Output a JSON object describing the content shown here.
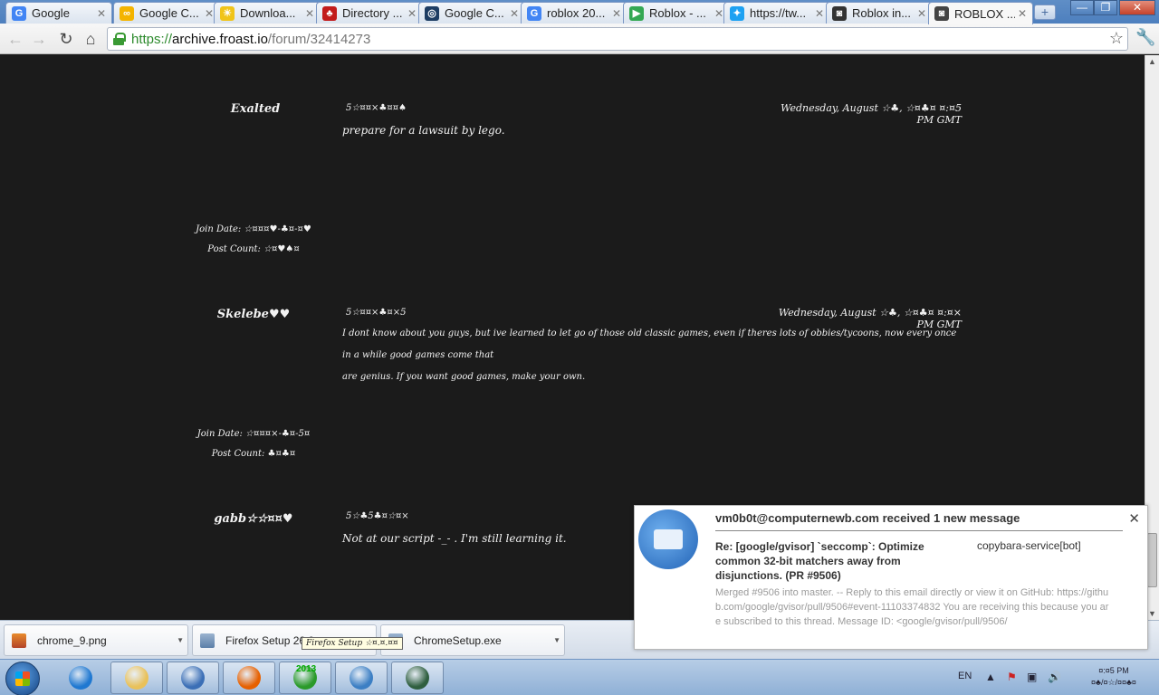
{
  "browser": {
    "tabs": [
      {
        "title": "Google",
        "favicon": "google-icon",
        "color": "#4285f4",
        "glyph": "G"
      },
      {
        "title": "Google C...",
        "favicon": "chrome-logo-icon",
        "color": "#f4b400",
        "glyph": "∞"
      },
      {
        "title": "Downloa...",
        "favicon": "lightbulb-icon",
        "color": "#f0c419",
        "glyph": "☀"
      },
      {
        "title": "Directory ...",
        "favicon": "cardinal-icon",
        "color": "#c21b1b",
        "glyph": "♣"
      },
      {
        "title": "Google C...",
        "favicon": "camera-icon",
        "color": "#1e3d63",
        "glyph": "◎"
      },
      {
        "title": "roblox 20...",
        "favicon": "google-icon",
        "color": "#4285f4",
        "glyph": "G"
      },
      {
        "title": "Roblox - ...",
        "favicon": "play-store-icon",
        "color": "#34a853",
        "glyph": "▶"
      },
      {
        "title": "https://tw...",
        "favicon": "twitter-icon",
        "color": "#1da1f2",
        "glyph": "✦"
      },
      {
        "title": "Roblox in...",
        "favicon": "roblox-icon",
        "color": "#333333",
        "glyph": "◙"
      },
      {
        "title": "ROBLOX ...",
        "favicon": "roblox-icon",
        "color": "#444444",
        "glyph": "◙",
        "active": true
      }
    ],
    "new_tab": "+",
    "window_controls": {
      "minimize": "—",
      "maximize": "❐",
      "close": "✕"
    },
    "url": {
      "scheme": "https://",
      "host": "archive.froast.io",
      "path": "/forum/32414273"
    },
    "nav": {
      "back": "←",
      "forward": "→",
      "reload": "↻",
      "home": "⌂"
    },
    "star": "☆",
    "wrench": "🔧"
  },
  "forum": {
    "posts": [
      {
        "username": "Exalted",
        "post_id": "5☆¤¤×♣¤¤♠",
        "date": "Wednesday, August ☆♣, ☆¤♣¤ ¤:¤5 PM GMT",
        "body": [
          "prepare for a lawsuit by lego."
        ],
        "join_date": "Join Date: ☆¤¤¤♥-♣¤-¤♥",
        "post_count": "Post Count: ☆¤♥♠¤"
      },
      {
        "username": "Skelebe♥♥",
        "post_id": "5☆¤¤×♣¤×5",
        "date": "Wednesday, August ☆♣, ☆¤♣¤ ¤:¤× PM GMT",
        "body": [
          "I dont know about you guys, but ive learned to let go of those old classic games, even if theres lots of obbies/tycoons, now every once in a while good games come that",
          "are genius. If you want good games, make your own."
        ],
        "join_date": "Join Date: ☆¤¤¤×-♣¤-5¤",
        "post_count": "Post Count: ♣¤♣¤"
      },
      {
        "username": "gabb☆☆¤¤♥",
        "post_id": "5☆♣5♣¤☆¤×",
        "date": "",
        "body": [
          "Not at our script -_- . I'm still learning it."
        ],
        "join_date": "",
        "post_count": ""
      }
    ]
  },
  "downloads": {
    "items": [
      {
        "name": "chrome_9.png",
        "icon": "image-file-icon"
      },
      {
        "name": "Firefox Setup 26.0...",
        "icon": "installer-file-icon"
      },
      {
        "name": "ChromeSetup.exe",
        "icon": "installer-file-icon"
      }
    ],
    "tooltip": "Firefox Setup ☆¤.¤.¤¤"
  },
  "notification": {
    "header": "vm0b0t@computernewb.com received 1 new message",
    "subject": "Re: [google/gvisor] `seccomp`: Optimize common 32-bit matchers away from disjunctions. (PR #9506)",
    "sender": "copybara-service[bot]",
    "body": "Merged #9506 into master. -- Reply to this email directly or view it on GitHub: https://github.com/google/gvisor/pull/9506#event-11103374832 You are receiving this because you are subscribed to this thread. Message ID: <google/gvisor/pull/9506/",
    "close": "✕"
  },
  "taskbar": {
    "apps": [
      {
        "name": "internet-explorer-icon",
        "color": "#1f78d1"
      },
      {
        "name": "file-explorer-icon",
        "color": "#e9c15a"
      },
      {
        "name": "chrome-icon",
        "color": "#3b6fb6"
      },
      {
        "name": "firefox-icon",
        "color": "#e66000"
      },
      {
        "name": "christmas-tree-icon",
        "color": "#2a9a2a",
        "badge": "2013"
      },
      {
        "name": "control-panel-icon",
        "color": "#3c7fc4"
      },
      {
        "name": "network-monitor-icon",
        "color": "#2f5f3f"
      }
    ],
    "language": "EN",
    "tray": [
      "▲",
      "⚑",
      "▣",
      "🔊"
    ],
    "clock_time": "¤:¤5 PM",
    "clock_date": "¤♣/¤☆/¤¤♣¤"
  }
}
